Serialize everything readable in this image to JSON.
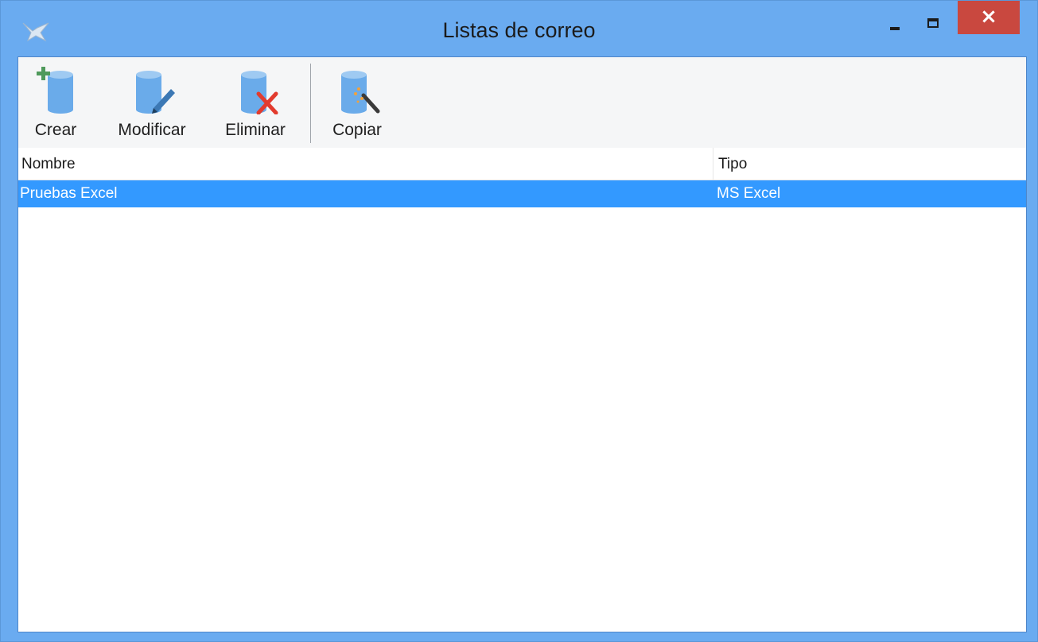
{
  "window": {
    "title": "Listas de correo",
    "controls": {
      "minimize_icon": "minimize-icon",
      "maximize_icon": "maximize-icon",
      "close_glyph": "×"
    }
  },
  "toolbar": {
    "items": [
      {
        "label": "Crear",
        "icon": "database-add-icon"
      },
      {
        "label": "Modificar",
        "icon": "database-edit-icon"
      },
      {
        "label": "Eliminar",
        "icon": "database-delete-icon"
      },
      {
        "label": "Copiar",
        "icon": "database-copy-icon"
      }
    ]
  },
  "list": {
    "columns": [
      "Nombre",
      "Tipo"
    ],
    "rows": [
      {
        "nombre": "Pruebas Excel",
        "tipo": "MS Excel",
        "selected": true
      }
    ]
  },
  "colors": {
    "frame": "#6aabf0",
    "close_button": "#c9483f",
    "selection": "#3399ff",
    "toolbar_bg": "#f5f6f7"
  }
}
